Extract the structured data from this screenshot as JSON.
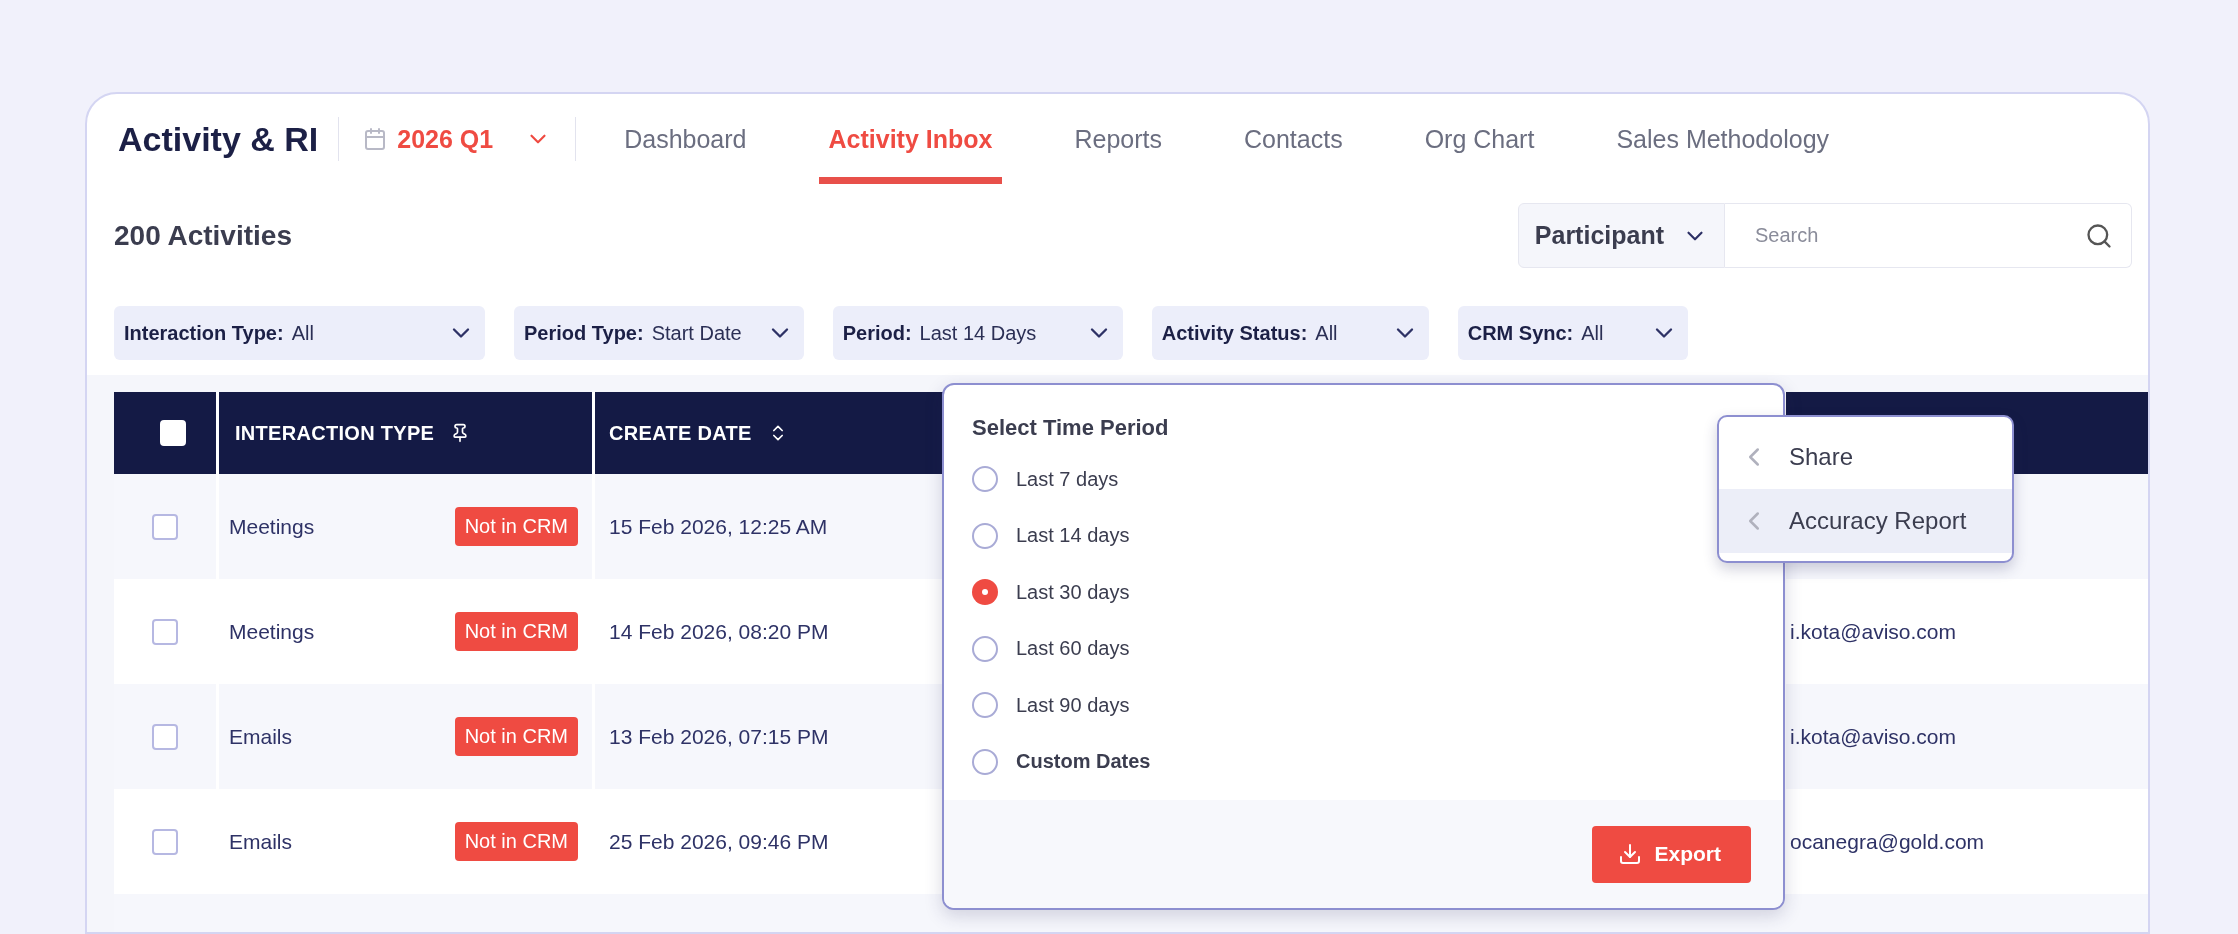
{
  "app_title": "Activity & RI",
  "period_picker": {
    "value": "2026 Q1"
  },
  "tabs": [
    {
      "label": "Dashboard",
      "selected": false
    },
    {
      "label": "Activity Inbox",
      "selected": true
    },
    {
      "label": "Reports",
      "selected": false
    },
    {
      "label": "Contacts",
      "selected": false
    },
    {
      "label": "Org Chart",
      "selected": false
    },
    {
      "label": "Sales Methodology",
      "selected": false
    }
  ],
  "activity_count": "200 Activities",
  "search": {
    "scope": "Participant",
    "placeholder": "Search"
  },
  "filters": [
    {
      "label": "Interaction Type:",
      "value": "All"
    },
    {
      "label": "Period Type:",
      "value": "Start Date"
    },
    {
      "label": "Period:",
      "value": "Last 14 Days"
    },
    {
      "label": "Activity Status:",
      "value": "All"
    },
    {
      "label": "CRM Sync:",
      "value": "All"
    }
  ],
  "table": {
    "select_all": {
      "checked": false
    },
    "columns": [
      {
        "label": "INTERACTION TYPE",
        "kind": "pinned"
      },
      {
        "label": "CREATE DATE",
        "kind": "sortable"
      }
    ],
    "rows": [
      {
        "checked": false,
        "interaction_type": "Meetings",
        "crm_status": "Not in CRM",
        "create_date": "15 Feb 2026, 12:25 AM"
      },
      {
        "checked": false,
        "interaction_type": "Meetings",
        "crm_status": "Not in CRM",
        "create_date": "14 Feb 2026, 08:20 PM",
        "column_4": "i.kota@aviso.com"
      },
      {
        "checked": false,
        "interaction_type": "Emails",
        "crm_status": "Not in CRM",
        "create_date": "13 Feb 2026, 07:15 PM",
        "column_4": "i.kota@aviso.com"
      },
      {
        "checked": false,
        "interaction_type": "Emails",
        "crm_status": "Not in CRM",
        "create_date": "25 Feb 2026, 09:46 PM",
        "column_4": "ocanegra@gold.com"
      }
    ]
  },
  "time_period_popover": {
    "title": "Select Time Period",
    "options": [
      {
        "label": "Last 7 days",
        "kind": "preset",
        "selected": false
      },
      {
        "label": "Last 14 days",
        "kind": "preset",
        "selected": false
      },
      {
        "label": "Last 30 days",
        "kind": "preset",
        "selected": true
      },
      {
        "label": "Last 60 days",
        "kind": "preset",
        "selected": false
      },
      {
        "label": "Last 90 days",
        "kind": "preset",
        "selected": false
      },
      {
        "label": "Custom Dates",
        "kind": "custom",
        "selected": false
      }
    ],
    "action": "Export"
  },
  "context_menu": {
    "items": [
      {
        "label": "Share",
        "selected": false
      },
      {
        "label": "Accuracy Report",
        "selected": true
      }
    ]
  }
}
